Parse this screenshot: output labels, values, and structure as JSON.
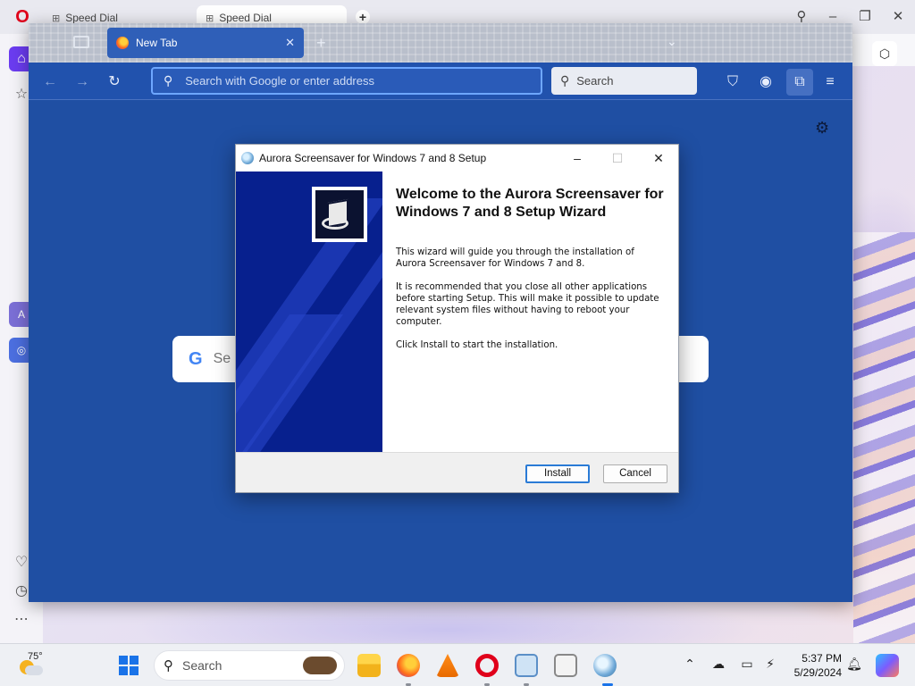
{
  "opera": {
    "tabs": [
      {
        "label": "Speed Dial"
      },
      {
        "label": "Speed Dial"
      }
    ],
    "new_tab_icon": "plus-icon",
    "controls": [
      "search-icon",
      "minimize-icon",
      "restore-icon",
      "close-icon"
    ]
  },
  "firefox": {
    "tab": {
      "label": "New Tab",
      "close": "✕"
    },
    "urlbar": {
      "placeholder": "Search with Google or enter address"
    },
    "searchbox": {
      "placeholder": "Search"
    },
    "google_search_partial": "Se"
  },
  "dialog": {
    "title": "Aurora Screensaver for Windows 7 and 8 Setup",
    "heading": "Welcome to the Aurora Screensaver for Windows 7 and 8 Setup Wizard",
    "paragraphs": [
      "This wizard will guide you through the installation of Aurora Screensaver for Windows 7 and 8.",
      "It is recommended that you close all other applications before starting Setup. This will make it possible to update relevant system files without having to reboot your computer.",
      "Click Install to start the installation."
    ],
    "buttons": {
      "install": "Install",
      "cancel": "Cancel"
    }
  },
  "taskbar": {
    "weather_temp": "75°",
    "search_placeholder": "Search",
    "clock_time": "5:37 PM",
    "clock_date": "5/29/2024",
    "apps": [
      "file-explorer-icon",
      "firefox-icon",
      "vlc-icon",
      "opera-icon",
      "notepad-icon",
      "solitaire-icon",
      "aurora-setup-icon"
    ]
  },
  "colors": {
    "firefox_bg": "#1f4fa3",
    "dialog_banner": "#07208e",
    "install_focus": "#2a7bd6",
    "opera_red": "#e0001b"
  }
}
